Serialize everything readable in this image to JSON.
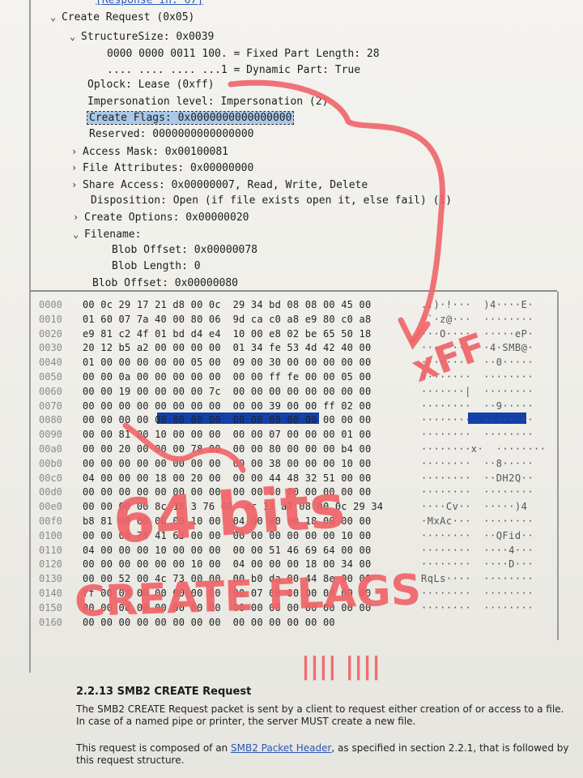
{
  "packet_tree": {
    "response_link": "[Response in: 67]",
    "create_request": "Create Request (0x05)",
    "structure_size": "StructureSize: 0x0039",
    "fixed_part": "0000 0000 0011 100. = Fixed Part Length: 28",
    "dynamic_part": ".... .... .... ...1 = Dynamic Part: True",
    "oplock": "Oplock: Lease (0xff)",
    "impersonation": "Impersonation level: Impersonation (2)",
    "create_flags": "Create Flags: 0x0000000000000000",
    "reserved": "Reserved: 0000000000000000",
    "access_mask": "Access Mask: 0x00100081",
    "file_attributes": "File Attributes: 0x00000000",
    "share_access": "Share Access: 0x00000007, Read, Write, Delete",
    "disposition": "Disposition: Open (if file exists open it, else fail) (1)",
    "create_options": "Create Options: 0x00000020",
    "filename": "Filename:",
    "blob_offset_inner": "Blob Offset: 0x00000078",
    "blob_length": "Blob Length: 0",
    "blob_offset": "Blob Offset: 0x00000080"
  },
  "hex_dump": {
    "rows": [
      {
        "offset": "0000",
        "bytes": "00 0c 29 17 21 d8 00 0c  29 34 bd 08 08 00 45 00",
        "ascii": "..)·!···  )4····E·"
      },
      {
        "offset": "0010",
        "bytes": "01 60 07 7a 40 00 80 06  9d ca c0 a8 e9 80 c0 a8",
        "ascii": "·`·z@···  ········"
      },
      {
        "offset": "0020",
        "bytes": "e9 81 c2 4f 01 bd d4 e4  10 00 e8 02 be 65 50 18",
        "ascii": "···O····  ·····eP·"
      },
      {
        "offset": "0030",
        "bytes": "20 12 b5 a2 00 00 00 00  01 34 fe 53 4d 42 40 00",
        "ascii": "········  ·4·SMB@·"
      },
      {
        "offset": "0040",
        "bytes": "01 00 00 00 00 00 05 00  09 00 30 00 00 00 00 00",
        "ascii": "········  ··0·····"
      },
      {
        "offset": "0050",
        "bytes": "00 00 0a 00 00 00 00 00  00 00 ff fe 00 00 05 00",
        "ascii": "········  ········"
      },
      {
        "offset": "0060",
        "bytes": "00 00 19 00 00 00 00 7c  00 00 00 00 00 00 00 00",
        "ascii": "·······|  ········"
      },
      {
        "offset": "0070",
        "bytes": "00 00 00 00 00 00 00 00  00 00 39 00 00 ff 02 00",
        "ascii": "········  ··9·····"
      },
      {
        "offset": "0080",
        "bytes": "00 00 00 00 00 00 00 00  00 00 00 00 00 00 00 00",
        "ascii": "········  ········"
      },
      {
        "offset": "0090",
        "bytes": "00 00 81 00 10 00 00 00  00 00 07 00 00 00 01 00",
        "ascii": "········  ········"
      },
      {
        "offset": "00a0",
        "bytes": "00 00 20 00 00 00 78 00  00 00 80 00 00 00 b4 00",
        "ascii": "········x·  ········"
      },
      {
        "offset": "00b0",
        "bytes": "00 00 00 00 00 00 00 00  00 00 38 00 00 00 10 00",
        "ascii": "········  ··8·····"
      },
      {
        "offset": "00c0",
        "bytes": "04 00 00 00 18 00 20 00  00 00 44 48 32 51 00 00",
        "ascii": "········  ··DH2Q··"
      },
      {
        "offset": "00d0",
        "bytes": "00 00 00 00 00 00 00 00  00 00 00 00 00 00 00 00",
        "ascii": "········  ········"
      },
      {
        "offset": "00e0",
        "bytes": "00 00 00 00 8c 18 3 76 00  ec 11 a7 08 00 0c 29 34",
        "ascii": "····Cv··  ·····)4"
      },
      {
        "offset": "00f0",
        "bytes": "b8 81 00 00 00 00 10 00  04 00 00 00 18 00 00 00",
        "ascii": "·MxAc···  ········"
      },
      {
        "offset": "0100",
        "bytes": "00 00 00 78 41 63 00 00  00 00 00 00 00 00 10 00",
        "ascii": "········  ··QFid··"
      },
      {
        "offset": "0110",
        "bytes": "04 00 00 00 10 00 00 00  00 00 51 46 69 64 00 00",
        "ascii": "········  ····4···"
      },
      {
        "offset": "0120",
        "bytes": "00 00 00 00 00 00 10 00  04 00 00 00 18 00 34 00",
        "ascii": "········  ····D···"
      },
      {
        "offset": "0130",
        "bytes": "00 00 52 00 4c 73 00 00  00 b0 da 00 44 8e 00 00",
        "ascii": "RqLs····  ········"
      },
      {
        "offset": "0140",
        "bytes": "ff 00 00 00 00 00 00 00  00 07 00 00 00 00 00 00",
        "ascii": "········  ········"
      },
      {
        "offset": "0150",
        "bytes": "00 00 00 00 00 00 00 00  00 00 00 00 00 00 00 00",
        "ascii": "········  ········"
      },
      {
        "offset": "0160",
        "bytes": "00 00 00 00 00 00 00 00  00 00 00 00 00 00",
        "ascii": ""
      }
    ]
  },
  "annotations": {
    "xff": "xFF",
    "bits": "64 bits",
    "flags": "CREATE FLAGS",
    "tally": "|||| ||||"
  },
  "doc": {
    "heading": "2.2.13 SMB2 CREATE Request",
    "para1_line1": "The SMB2 CREATE Request packet is sent by a client to request either creation of or access to a file.",
    "para1_line2": "In case of a named pipe or printer, the server MUST create a new file.",
    "para2_prefix": "This request is composed of an ",
    "para2_link": "SMB2 Packet Header",
    "para2_suffix": ", as specified in section 2.2.1, that is followed by",
    "para2_line2": "this request structure."
  },
  "colors": {
    "marker": "#f06468",
    "selection": "#1240a8",
    "highlight": "#aac8e8"
  }
}
